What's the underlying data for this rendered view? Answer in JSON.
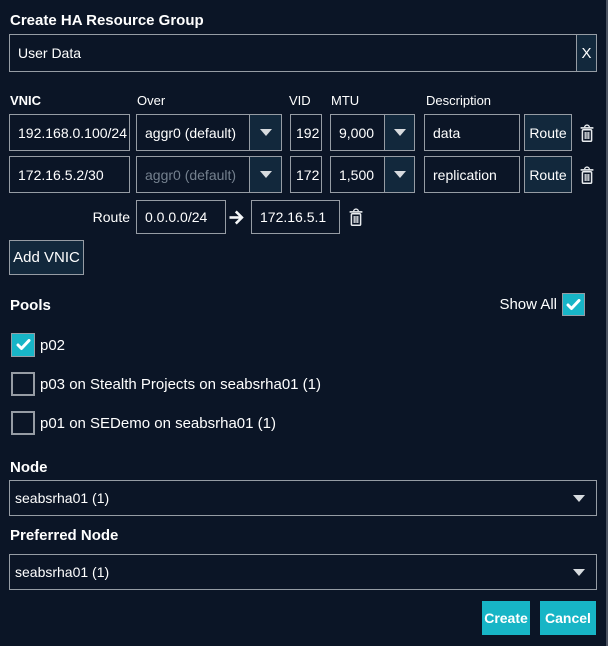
{
  "dialog": {
    "title": "Create HA Resource Group"
  },
  "name_field": {
    "value": "User Data",
    "clear_label": "X"
  },
  "vnic_table": {
    "headers": {
      "vnic": "VNIC",
      "over": "Over",
      "vid": "VID",
      "mtu": "MTU",
      "description": "Description"
    },
    "rows": [
      {
        "address": "192.168.0.100/24",
        "over": "aggr0 (default)",
        "vid": "192",
        "mtu": "9,000",
        "description": "data",
        "route_label": "Route"
      },
      {
        "address": "172.16.5.2/30",
        "over": "aggr0 (default)",
        "vid": "172",
        "mtu": "1,500",
        "description": "replication",
        "route_label": "Route"
      }
    ],
    "route_row": {
      "label": "Route",
      "network": "0.0.0.0/24",
      "arrow": "→",
      "gateway": "172.16.5.1"
    },
    "add_button": "Add VNIC"
  },
  "pools": {
    "label": "Pools",
    "show_all_label": "Show All",
    "show_all_checked": true,
    "items": [
      {
        "label": "p02",
        "checked": true
      },
      {
        "label": "p03 on Stealth Projects on seabsrha01 (1)",
        "checked": false
      },
      {
        "label": "p01 on SEDemo on seabsrha01 (1)",
        "checked": false
      }
    ]
  },
  "node": {
    "label": "Node",
    "value": "seabsrha01 (1)"
  },
  "preferred_node": {
    "label": "Preferred Node",
    "value": "seabsrha01 (1)"
  },
  "actions": {
    "create": "Create",
    "cancel": "Cancel"
  },
  "colors": {
    "background": "#0B1526",
    "panel_button": "#12283C",
    "border": "#969CA4",
    "accent_cyan": "#17B5C6",
    "text": "#FFFFFF",
    "disabled_text": "#74808E"
  }
}
